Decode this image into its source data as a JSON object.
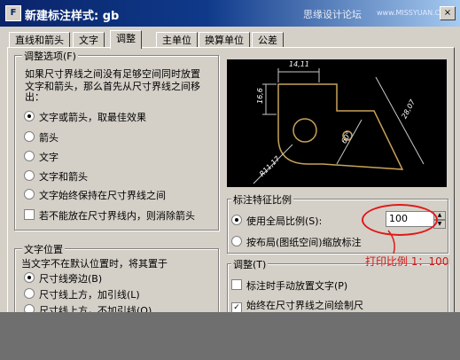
{
  "window": {
    "app_icon": "F",
    "title": "新建标注样式: gb",
    "watermark": "思缘设计论坛",
    "watermark_url": "www.MISSYUAN.COM",
    "close_glyph": "×"
  },
  "tabs": [
    {
      "label": "直线和箭头",
      "active": false
    },
    {
      "label": "文字",
      "active": false
    },
    {
      "label": "调整",
      "active": true
    },
    {
      "label": "主单位",
      "active": false
    },
    {
      "label": "换算单位",
      "active": false
    },
    {
      "label": "公差",
      "active": false
    }
  ],
  "fit_options": {
    "legend": "调整选项(F)",
    "description_line1": "如果尺寸界线之间没有足够空间同时放置",
    "description_line2": "文字和箭头，那么首先从尺寸界线之间移",
    "description_line3": "出：",
    "options": [
      {
        "label": "文字或箭头，取最佳效果",
        "selected": true
      },
      {
        "label": "箭头",
        "selected": false
      },
      {
        "label": "文字",
        "selected": false
      },
      {
        "label": "文字和箭头",
        "selected": false
      },
      {
        "label": "文字始终保持在尺寸界线之间",
        "selected": false
      }
    ],
    "suppress_label": "若不能放在尺寸界线内，则消除箭头",
    "suppress_checked": false
  },
  "text_placement": {
    "legend": "文字位置",
    "description": "当文字不在默认位置时，将其置于",
    "options": [
      {
        "label": "尺寸线旁边(B)",
        "selected": true
      },
      {
        "label": "尺寸线上方，加引线(L)",
        "selected": false
      },
      {
        "label": "尺寸线上方，不加引线(O)",
        "selected": false
      }
    ]
  },
  "preview": {
    "dim_top": "14,11",
    "dim_left": "16,6",
    "dim_right": "28,07",
    "dim_angle": "60°",
    "dim_radius": "R11,17"
  },
  "scale": {
    "legend": "标注特征比例",
    "overall_label": "使用全局比例(S):",
    "overall_selected": true,
    "overall_value": "100",
    "layout_label": "按布局(图纸空间)缩放标注",
    "layout_selected": false
  },
  "fine_tuning": {
    "legend": "调整(T)",
    "manual_label": "标注时手动放置文字(P)",
    "manual_checked": false,
    "always_label": "始终在尺寸界线之间绘制尺",
    "always_checked": true
  },
  "annotation": {
    "text": "打印比例 1：100",
    "color": "#d01a1a"
  },
  "colors": {
    "dim_lines": "#c9c9c9",
    "part_outline": "#c8a25a",
    "highlight": "#e11818"
  }
}
